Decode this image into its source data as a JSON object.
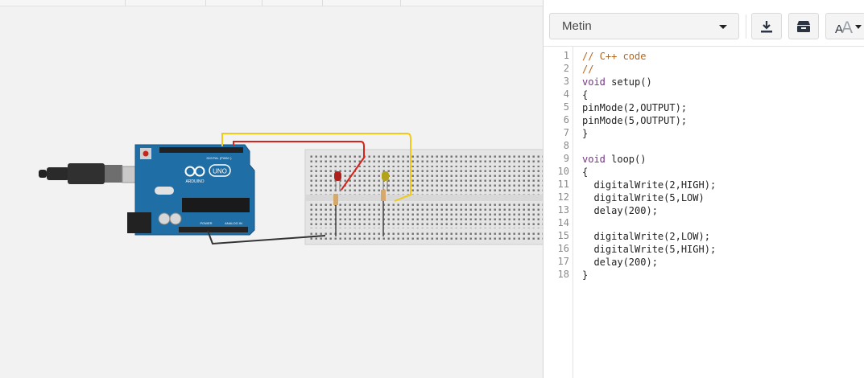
{
  "panel": {
    "mode_label": "Metin",
    "font_button_label": "A"
  },
  "code": {
    "line_numbers": [
      "1",
      "2",
      "3",
      "4",
      "5",
      "6",
      "7",
      "8",
      "9",
      "10",
      "11",
      "12",
      "13",
      "14",
      "15",
      "16",
      "17",
      "18"
    ],
    "lines": [
      {
        "text": "// C++ code",
        "kind": "comment"
      },
      {
        "text": "//",
        "kind": "comment"
      },
      {
        "keyword": "void",
        "rest": " setup()",
        "kind": "keyword"
      },
      {
        "text": "{",
        "kind": "plain"
      },
      {
        "text": "pinMode(2,OUTPUT);",
        "kind": "plain"
      },
      {
        "text": "pinMode(5,OUTPUT);",
        "kind": "plain"
      },
      {
        "text": "}",
        "kind": "plain"
      },
      {
        "text": "",
        "kind": "plain"
      },
      {
        "keyword": "void",
        "rest": " loop()",
        "kind": "keyword"
      },
      {
        "text": "{",
        "kind": "plain"
      },
      {
        "text": "  digitalWrite(2,HIGH);",
        "kind": "plain"
      },
      {
        "text": "  digitalWrite(5,LOW)",
        "kind": "plain"
      },
      {
        "text": "  delay(200);",
        "kind": "plain"
      },
      {
        "text": "",
        "kind": "plain"
      },
      {
        "text": "  digitalWrite(2,LOW);",
        "kind": "plain"
      },
      {
        "text": "  digitalWrite(5,HIGH);",
        "kind": "plain"
      },
      {
        "text": "  delay(200);",
        "kind": "plain"
      },
      {
        "text": "}",
        "kind": "plain"
      }
    ]
  },
  "circuit": {
    "board_label": "UNO",
    "board_brand": "ARDUINO",
    "digital_header_label": "DIGITAL (PWM~)",
    "power_label": "POWER",
    "analog_label": "ANALOG IN",
    "led_colors": {
      "red": "#b0201a",
      "yellow": "#b3a21c"
    },
    "wire_colors": {
      "red": "#d8231b",
      "yellow": "#f2c916",
      "black": "#333333"
    }
  }
}
